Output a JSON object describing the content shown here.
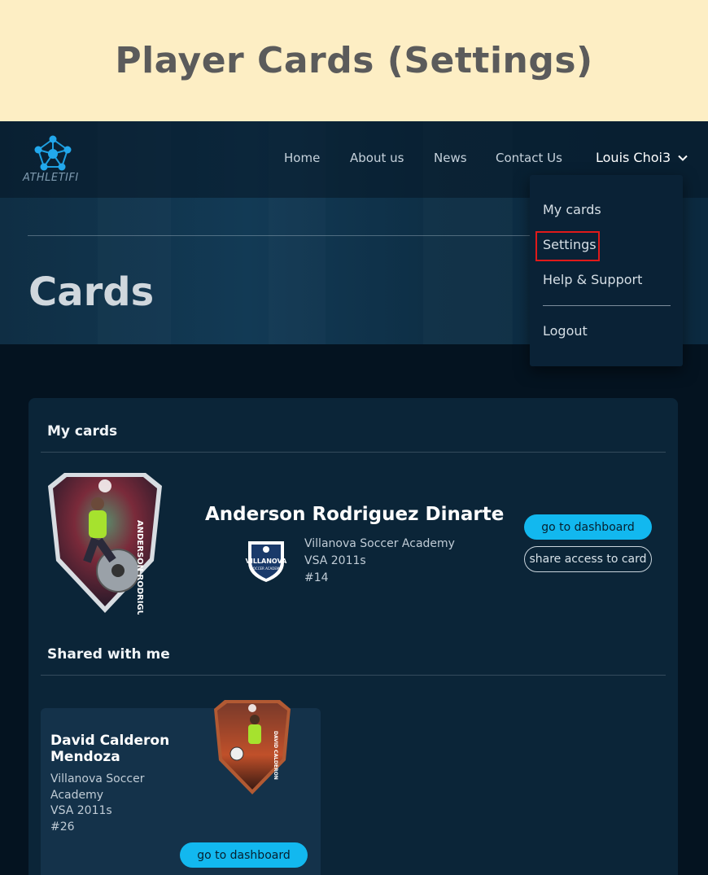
{
  "banner": {
    "title": "Player Cards (Settings)"
  },
  "brand": {
    "logo_text": "ATHLETIFI"
  },
  "nav": {
    "items": [
      "Home",
      "About us",
      "News",
      "Contact Us"
    ],
    "user_name": "Louis Choi3"
  },
  "dropdown": {
    "items": [
      "My cards",
      "Settings",
      "Help & Support",
      "Logout"
    ],
    "highlighted": "Settings"
  },
  "page": {
    "title": "Cards"
  },
  "my_cards": {
    "heading": "My cards",
    "card": {
      "player_name": "Anderson Rodriguez Dinarte",
      "club": "Villanova Soccer Academy",
      "team": "VSA 2011s",
      "number": "#14",
      "card_surname": "ANDERSON RODRIGUEZ",
      "club_logo_text": "VILLANOVA",
      "club_logo_sub": "SOCCER ACADEMY",
      "dashboard_label": "go to dashboard",
      "share_label": "share access to card"
    }
  },
  "shared": {
    "heading": "Shared with me",
    "card": {
      "player_name": "David Calderon Mendoza",
      "club_line1": "Villanova Soccer",
      "club_line2": "Academy",
      "team": "VSA 2011s",
      "number": "#26",
      "card_surname": "DAVID CALDERON",
      "dashboard_label": "go to dashboard"
    }
  },
  "colors": {
    "accent": "#12b8ef",
    "banner_bg": "#fdeec4",
    "page_bg": "#041320",
    "panel_bg": "#0b2538",
    "highlight": "#e01a1a"
  }
}
